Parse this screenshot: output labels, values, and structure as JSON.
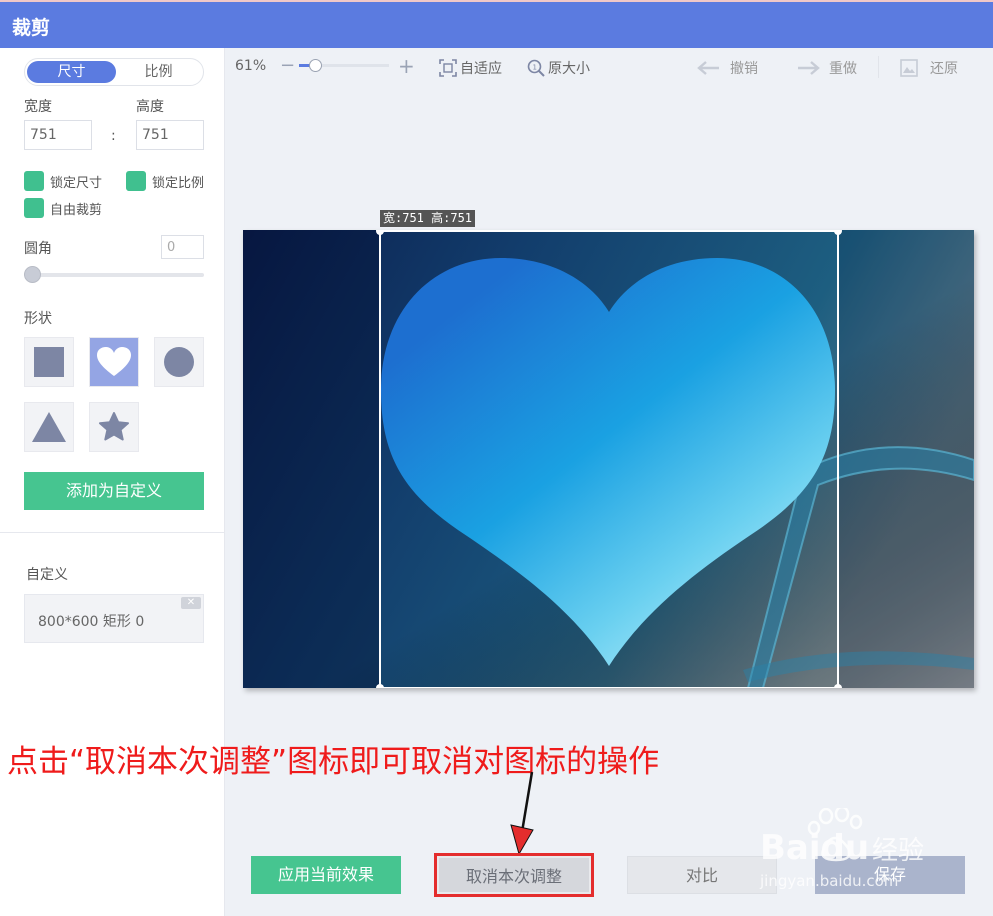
{
  "window": {
    "title": "裁剪"
  },
  "sidebar": {
    "tabs": [
      "尺寸",
      "比例"
    ],
    "width_label": "宽度",
    "height_label": "高度",
    "width_value": "751",
    "height_value": "751",
    "separator": ":",
    "checkboxes": [
      "锁定尺寸",
      "锁定比例",
      "自由裁剪"
    ],
    "radius_label": "圆角",
    "radius_value": "0",
    "radius_level": 0,
    "shape_label": "形状",
    "shapes": [
      "square-shape",
      "heart-shape",
      "circle-shape",
      "triangle-shape",
      "star-shape"
    ],
    "selected_shape": "heart-shape",
    "add_custom_label": "添加为自定义",
    "custom_label": "自定义",
    "custom_item": "800*600 矩形 0"
  },
  "toolbar": {
    "zoom": "61%",
    "zoom_level": 0.15,
    "fit_label": "自适应",
    "original_label": "原大小",
    "undo_label": "撤销",
    "redo_label": "重做",
    "restore_label": "还原"
  },
  "canvas": {
    "crop_size_label": "宽:751 高:751"
  },
  "annotation": {
    "text": "点击“取消本次调整”图标即可取消对图标的操作"
  },
  "bottom": {
    "apply_label": "应用当前效果",
    "cancel_label": "取消本次调整",
    "compare_label": "对比",
    "save_label": "保存"
  },
  "watermark": {
    "brand": "Baidu",
    "suffix": "经验",
    "url": "jingyan.baidu.com"
  },
  "colors": {
    "accent": "#5b7be0",
    "green": "#46c590",
    "annotation_red": "#ef1b1b"
  }
}
